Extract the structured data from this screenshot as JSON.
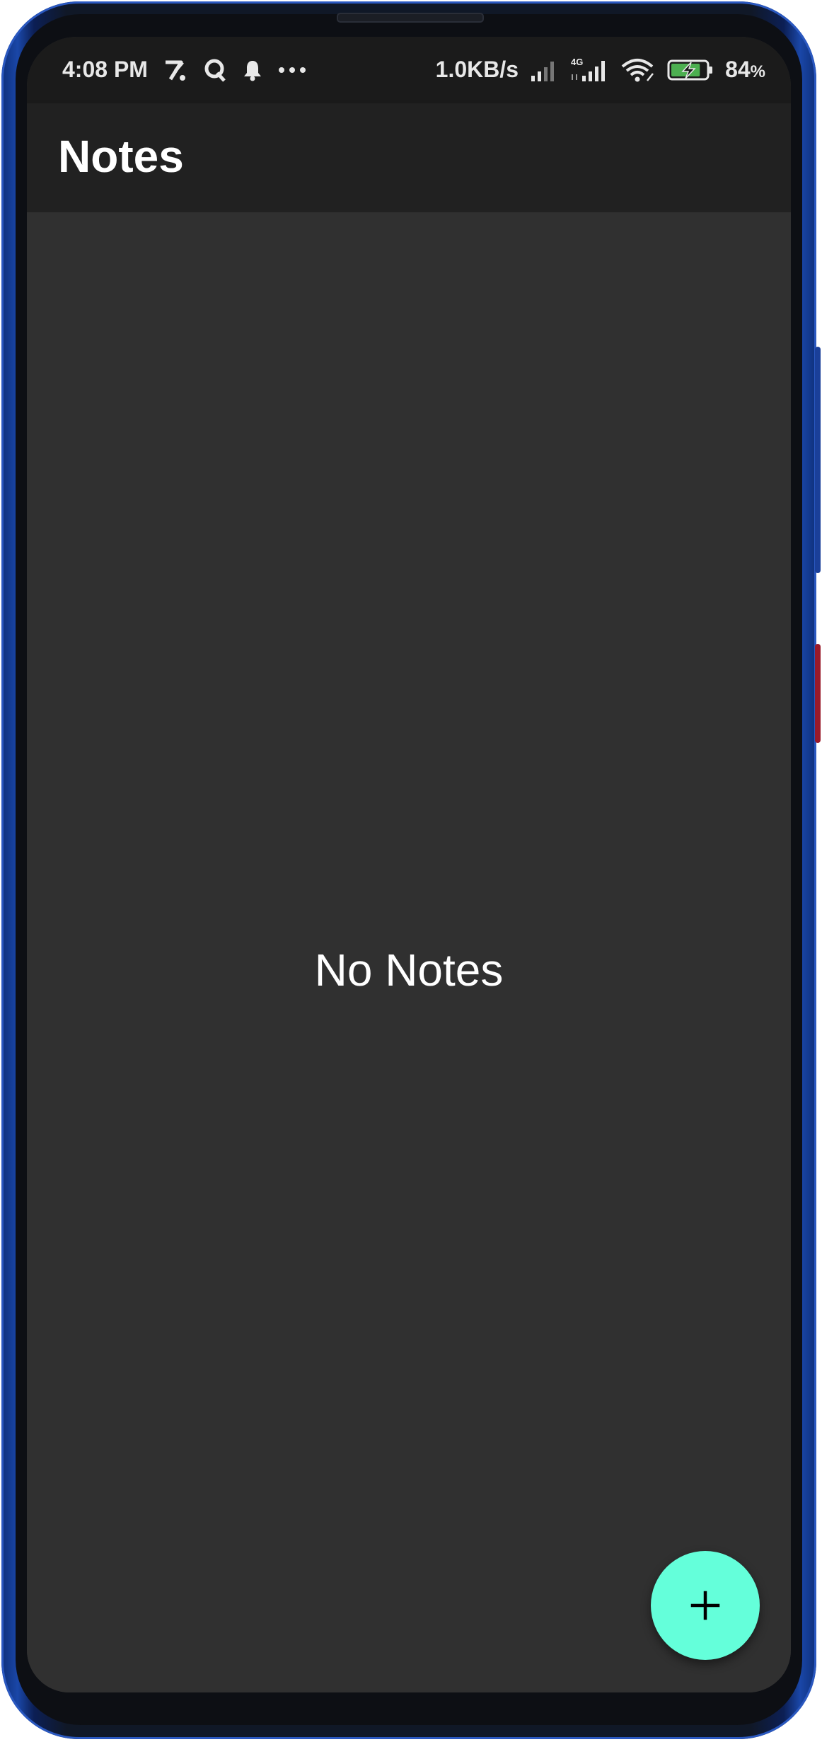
{
  "status_bar": {
    "time": "4:08 PM",
    "network_speed": "1.0KB/s",
    "network_type": "4G",
    "battery_percent": "84",
    "battery_unit": "%",
    "battery_level": 0.84,
    "icons": [
      "zomato-icon",
      "q-icon",
      "notification-bell-icon",
      "more-dots-icon",
      "signal-icon",
      "signal-4g-icon",
      "wifi-icon",
      "battery-charging-icon"
    ]
  },
  "app_bar": {
    "title": "Notes"
  },
  "content": {
    "empty_message": "No Notes"
  },
  "fab": {
    "icon": "plus-icon",
    "color": "#64ffda"
  },
  "colors": {
    "status_bar_bg": "#1b1b1b",
    "app_bar_bg": "#212121",
    "screen_bg": "#303030",
    "accent": "#64ffda",
    "battery_green": "#4caf50"
  }
}
